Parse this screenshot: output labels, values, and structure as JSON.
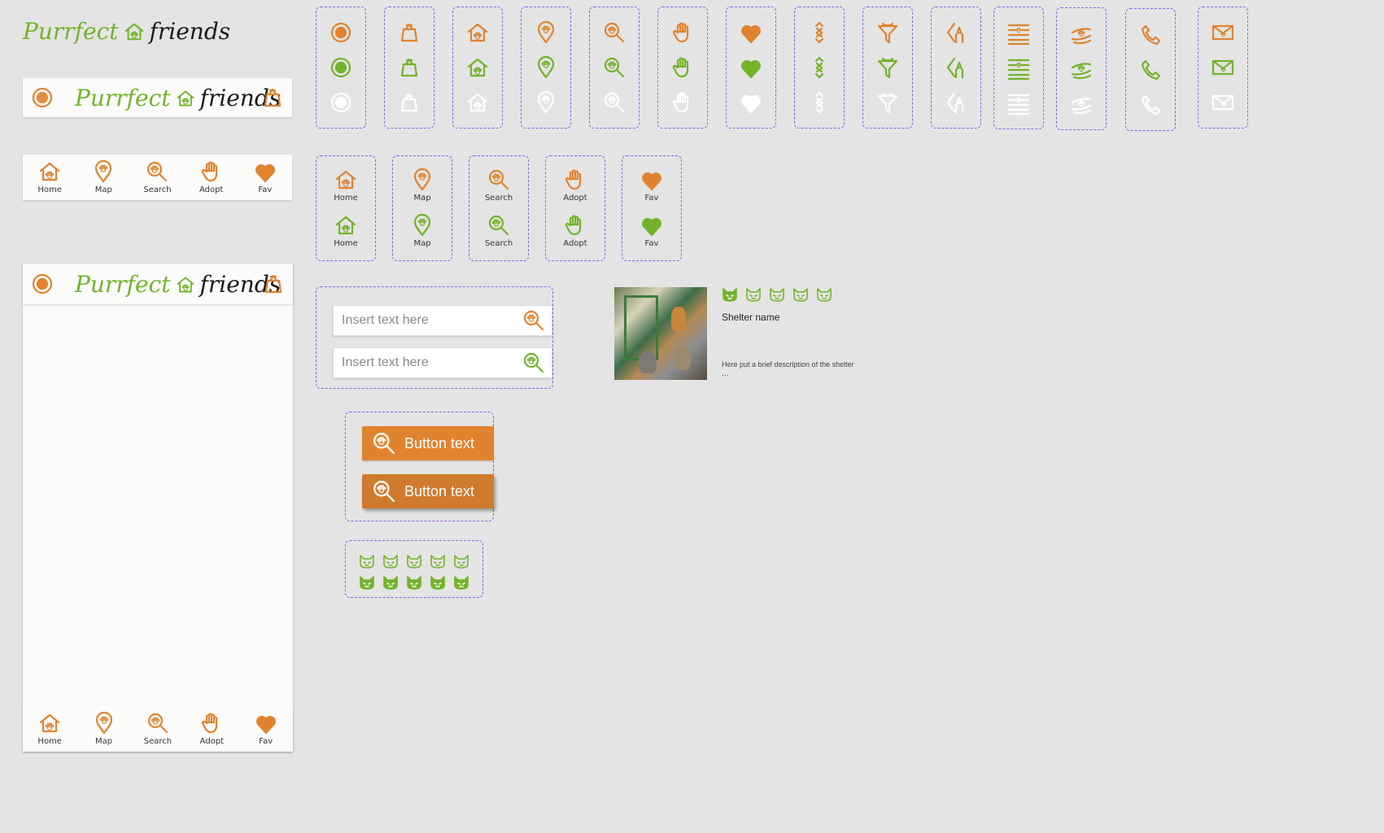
{
  "logo": {
    "part1": "Purrfect",
    "part2": "friends"
  },
  "nav": [
    {
      "label": "Home",
      "icon": "home-paw-icon"
    },
    {
      "label": "Map",
      "icon": "map-pin-paw-icon"
    },
    {
      "label": "Search",
      "icon": "search-paw-icon"
    },
    {
      "label": "Adopt",
      "icon": "adopt-hand-icon"
    },
    {
      "label": "Fav",
      "icon": "heart-paws-icon"
    }
  ],
  "icon_sets": [
    "account-circle-icon",
    "bag-icon",
    "home-paw-icon",
    "map-pin-paw-icon",
    "search-paw-icon",
    "adopt-hand-icon",
    "heart-paws-icon",
    "sort-icon",
    "filter-icon",
    "share-icon",
    "list-icon",
    "care-hands-icon",
    "phone-icon",
    "mail-icon"
  ],
  "icon_colors": [
    "#e0832f",
    "#72b32a",
    "#ffffff"
  ],
  "inputs": {
    "placeholder": "Insert text here"
  },
  "buttons": {
    "label": "Button text",
    "colors": [
      "#e0832f",
      "#cf7a2d"
    ]
  },
  "shelter": {
    "name": "Shelter name",
    "description": "Here put a brief description of the shelter",
    "description_more": "...",
    "rating": 1,
    "rating_max": 5
  },
  "ratings_demo": {
    "count": 5
  }
}
